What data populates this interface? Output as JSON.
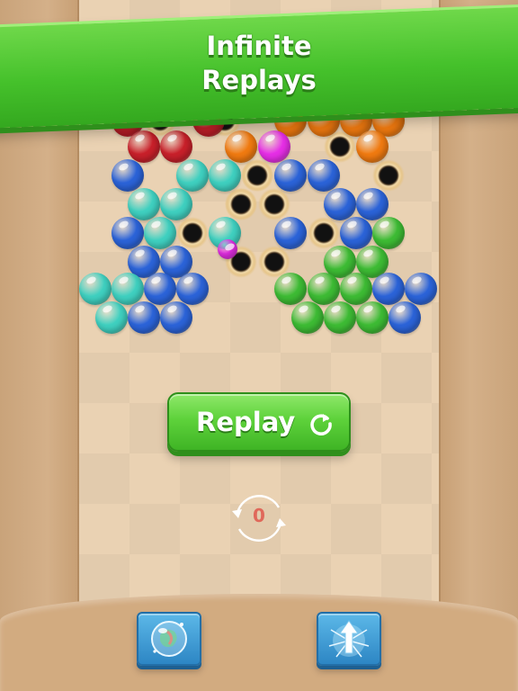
{
  "banner": {
    "line1": "Infinite",
    "line2": "Replays"
  },
  "replay_button": {
    "label": "Replay",
    "icon": "refresh-icon"
  },
  "counter": {
    "value": "0",
    "icon": "cycle-arrows-icon"
  },
  "powerups": [
    {
      "name": "bubble-swap",
      "icon": "bubble-icon"
    },
    {
      "name": "arrow-shot",
      "icon": "arrow-burst-icon"
    }
  ],
  "colors": {
    "banner_green": "#45c12b",
    "board": "#ead2b3",
    "wall": "#c9a37a",
    "counter_red": "#e0685a",
    "powerup_blue": "#2d86c4"
  },
  "bubble_colors": {
    "red": "#c8202a",
    "orange": "#f07a10",
    "magenta": "#e62ee6",
    "blue": "#2b63d8",
    "cyan": "#3fd0c0",
    "green": "#3dbb34"
  },
  "bubble_field": [
    {
      "color": "red"
    },
    {
      "color": "red"
    },
    {
      "color": "orange"
    },
    {
      "color": "orange"
    },
    {
      "color": "orange"
    },
    {
      "color": "orange"
    },
    {
      "color": "red"
    },
    {
      "color": "red"
    },
    {
      "color": "orange"
    },
    {
      "color": "magenta"
    },
    {
      "color": "orange"
    },
    {
      "color": "blue"
    },
    {
      "color": "cyan"
    },
    {
      "color": "cyan"
    },
    {
      "color": "blue"
    },
    {
      "color": "blue"
    },
    {
      "color": "cyan"
    },
    {
      "color": "cyan"
    },
    {
      "color": "blue"
    },
    {
      "color": "blue"
    },
    {
      "color": "blue"
    },
    {
      "color": "cyan"
    },
    {
      "color": "cyan"
    },
    {
      "color": "blue"
    },
    {
      "color": "blue"
    },
    {
      "color": "green"
    },
    {
      "color": "blue"
    },
    {
      "color": "blue"
    },
    {
      "color": "green"
    },
    {
      "color": "green"
    },
    {
      "color": "cyan"
    },
    {
      "color": "cyan"
    },
    {
      "color": "blue"
    },
    {
      "color": "blue"
    },
    {
      "color": "green"
    },
    {
      "color": "green"
    },
    {
      "color": "green"
    },
    {
      "color": "blue"
    },
    {
      "color": "blue"
    },
    {
      "color": "cyan"
    },
    {
      "color": "blue"
    },
    {
      "color": "blue"
    },
    {
      "color": "green"
    },
    {
      "color": "green"
    },
    {
      "color": "green"
    },
    {
      "color": "blue"
    },
    {
      "color": "magenta",
      "small": true
    }
  ],
  "holes": 13
}
